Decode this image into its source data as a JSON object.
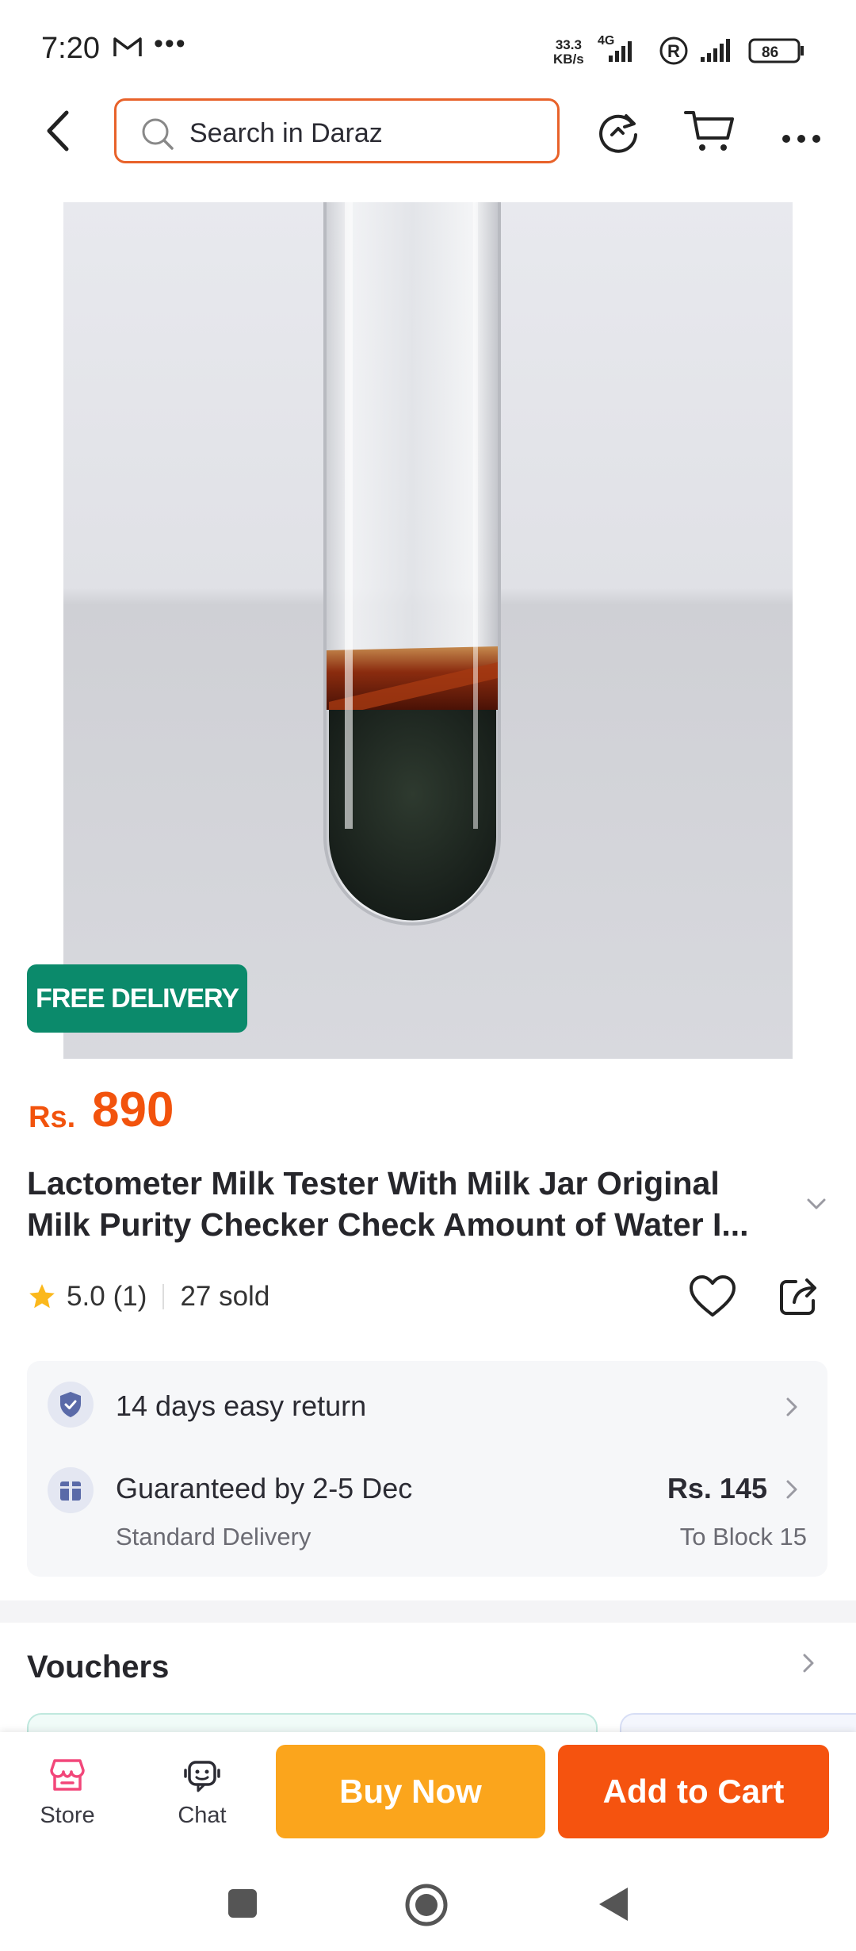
{
  "status_bar": {
    "time": "7:20",
    "more": "•••",
    "speed_value": "33.3",
    "speed_unit": "KB/s",
    "network": "4G",
    "battery": "86"
  },
  "header": {
    "search_placeholder": "Search in Daraz"
  },
  "product": {
    "badge": "FREE DELIVERY",
    "currency": "Rs.",
    "price": "890",
    "title_line1": "Lactometer Milk Tester With Milk Jar Original",
    "title_line2": "Milk Purity Checker Check Amount of Water I...",
    "rating": "5.0",
    "review_count": "(1)",
    "sold": "27 sold"
  },
  "service": {
    "return_label": "14 days easy return",
    "delivery_label": "Guaranteed by 2-5 Dec",
    "delivery_type": "Standard Delivery",
    "delivery_fee": "Rs. 145",
    "delivery_location": "To Block 15"
  },
  "vouchers": {
    "title": "Vouchers"
  },
  "action_bar": {
    "store_label": "Store",
    "chat_label": "Chat",
    "buy_now_label": "Buy Now",
    "add_to_cart_label": "Add to Cart"
  },
  "colors": {
    "brand_orange": "#f2530d",
    "buy_now": "#fba51c",
    "free_delivery": "#0b8a6b",
    "search_border": "#e8622a"
  }
}
